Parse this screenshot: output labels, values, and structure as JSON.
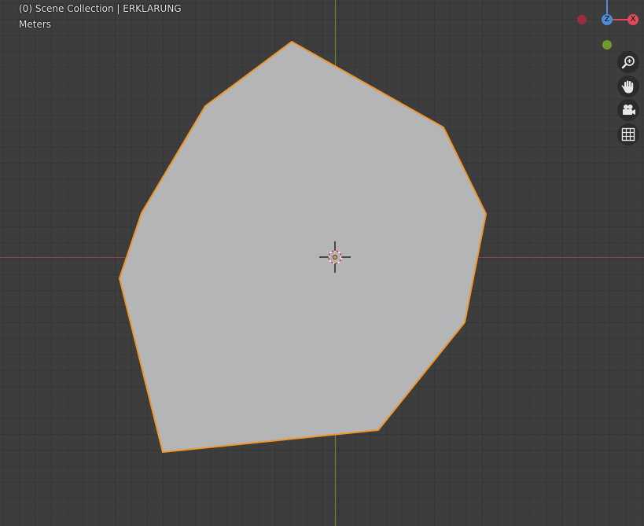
{
  "viewport": {
    "scene_info": "(0) Scene Collection | ERKLARUNG",
    "units": "Meters"
  },
  "gizmo": {
    "z_label": "Z",
    "x_label": "X",
    "colors": {
      "x": "#e04a5d",
      "z": "#4c8dd9",
      "neg_x": "#9b2e3e",
      "neg_y": "#6e9a2b"
    }
  },
  "nav_buttons": [
    {
      "icon": "zoom-icon"
    },
    {
      "icon": "hand-pan-icon"
    },
    {
      "icon": "camera-icon"
    },
    {
      "icon": "grid-icon"
    }
  ],
  "colors": {
    "background": "#3d3d3d",
    "mesh_fill": "#b4b5b7",
    "selection_outline": "#f0952a",
    "x_axis": "#9a3c42",
    "y_axis": "#6b8a2a"
  }
}
